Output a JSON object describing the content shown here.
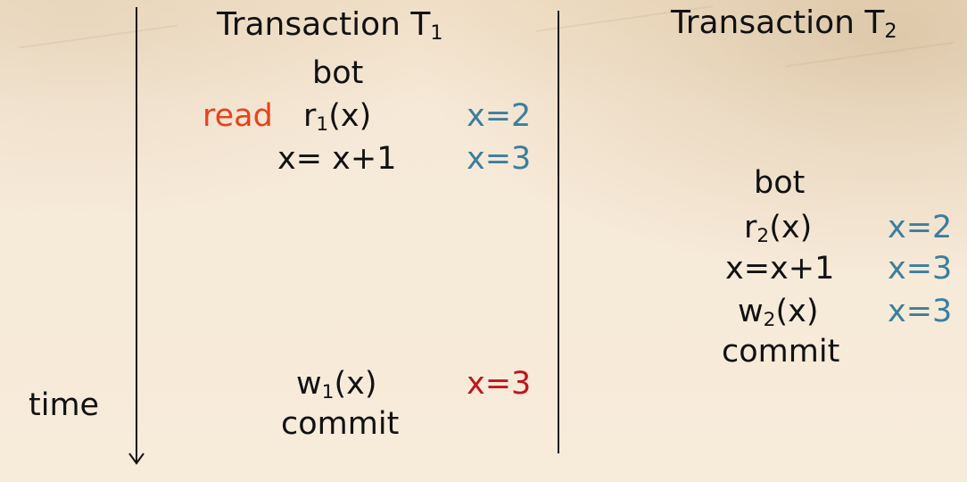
{
  "t1": {
    "heading": "Transaction T",
    "heading_sub": "1",
    "rows": [
      {
        "op_text": "bot"
      },
      {
        "prefix": "read",
        "op_text": "r",
        "op_sub": "1",
        "op_tail": "(x)",
        "value": "x=2"
      },
      {
        "op_text": "x= x+1",
        "value": "x=3"
      },
      {
        "op_text": "w",
        "op_sub": "1",
        "op_tail": "(x)",
        "value": "x=3"
      },
      {
        "op_text": "commit"
      }
    ]
  },
  "t2": {
    "heading": "Transaction T",
    "heading_sub": "2",
    "rows": [
      {
        "op_text": "bot"
      },
      {
        "op_text": "r",
        "op_sub": "2",
        "op_tail": "(x)",
        "value": "x=2"
      },
      {
        "op_text": "x=x+1",
        "value": "x=3"
      },
      {
        "op_text": "w",
        "op_sub": "2",
        "op_tail": "(x)",
        "value": "x=3"
      },
      {
        "op_text": "commit"
      }
    ]
  },
  "time_label": "time",
  "colors": {
    "value_blue": "#3a7f9e",
    "read_red": "#e8411c",
    "write_red": "#c2141a",
    "text": "#111111",
    "background": "#f6e9d7"
  }
}
